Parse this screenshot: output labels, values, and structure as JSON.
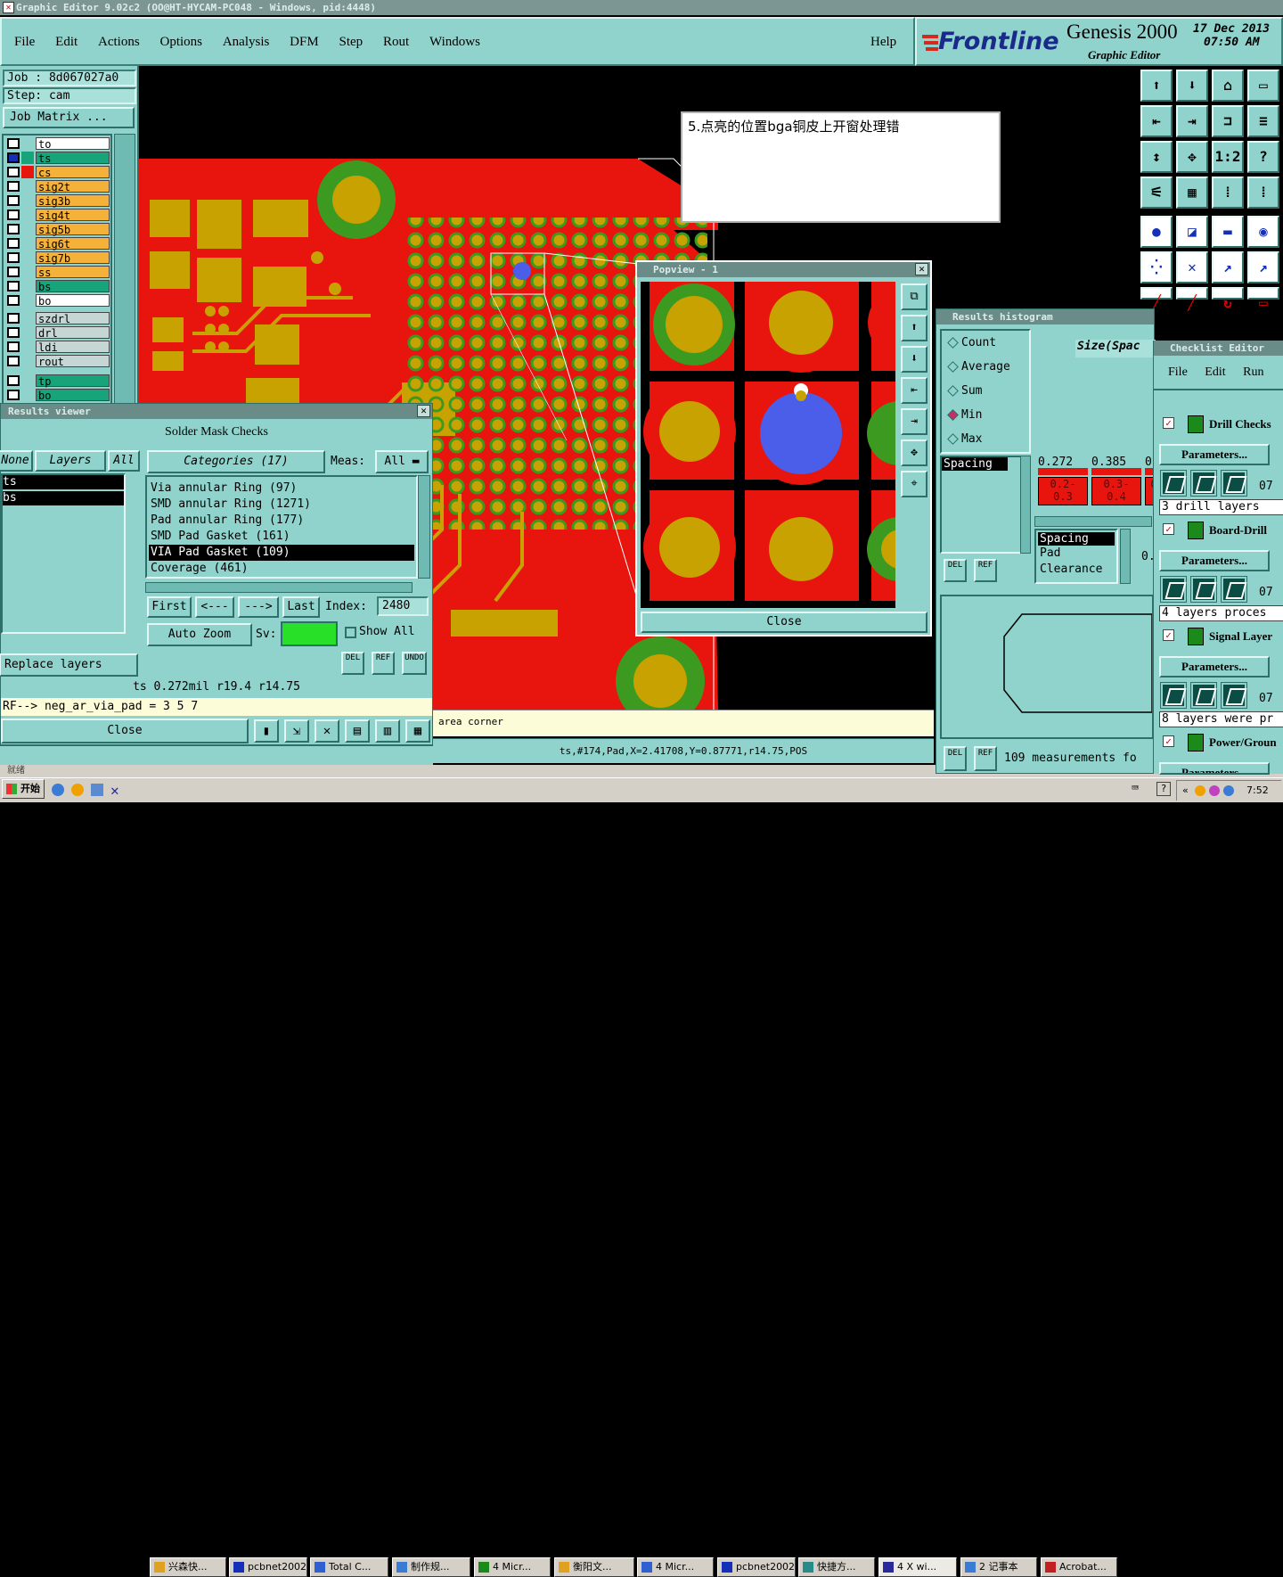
{
  "window_title": "Graphic Editor 9.02c2 (OO@HT-HYCAM-PC048 - Windows, pid:4448)",
  "menu": [
    "File",
    "Edit",
    "Actions",
    "Options",
    "Analysis",
    "DFM",
    "Step",
    "Rout",
    "Windows"
  ],
  "help": "Help",
  "brand": {
    "logo": "Frontline",
    "product": "Genesis 2000",
    "subtitle": "Graphic Editor",
    "date": "17 Dec 2013",
    "time": "07:50 AM"
  },
  "job": {
    "job_label": "Job : 8d067027a0",
    "step_label": "Step: cam",
    "matrix_button": "Job Matrix ..."
  },
  "layers": [
    {
      "name": "to",
      "color": "#ffffff"
    },
    {
      "name": "ts",
      "color": "#18a47a"
    },
    {
      "name": "cs",
      "color": "#f5b23a"
    },
    {
      "name": "sig2t",
      "color": "#f5b23a"
    },
    {
      "name": "sig3b",
      "color": "#f5b23a"
    },
    {
      "name": "sig4t",
      "color": "#f5b23a"
    },
    {
      "name": "sig5b",
      "color": "#f5b23a"
    },
    {
      "name": "sig6t",
      "color": "#f5b23a"
    },
    {
      "name": "sig7b",
      "color": "#f5b23a"
    },
    {
      "name": "ss",
      "color": "#f5b23a"
    },
    {
      "name": "bs",
      "color": "#18a47a"
    },
    {
      "name": "bo",
      "color": "#ffffff"
    }
  ],
  "layers2": [
    "szdrl",
    "drl",
    "ldi",
    "rout"
  ],
  "layers3": [
    "tp",
    "bo"
  ],
  "annotation": "5.点亮的位置bga铜皮上开窗处理错",
  "results_viewer": {
    "title": "Results viewer",
    "header": "Solder Mask Checks",
    "none_btn": "None",
    "layers_btn": "Layers",
    "all_btn": "All",
    "categories_btn": "Categories (17)",
    "meas_label": "Meas:",
    "meas_value": "All",
    "left_list": [
      "ts",
      "bs"
    ],
    "categories": [
      "Via annular Ring (97)",
      "SMD annular Ring (1271)",
      "Pad annular Ring (177)",
      "SMD Pad Gasket (161)",
      "VIA Pad Gasket (109)",
      "Coverage (461)"
    ],
    "selected_index": 4,
    "first": "First",
    "prev": "<---",
    "next": "--->",
    "last": "Last",
    "index_label": "Index:",
    "index_value": "2480",
    "auto_zoom": "Auto Zoom",
    "sv_label": "Sv:",
    "show_all": "Show All",
    "replace_layers": "Replace layers",
    "del": "DEL",
    "ref": "REF",
    "undo": "UNDO",
    "status_line": "ts 0.272mil   r19.4   r14.75",
    "rf_line": "RF--> neg_ar_via_pad = 3 5 7",
    "close": "Close"
  },
  "popview": {
    "title": "Popview - 1",
    "close": "Close"
  },
  "histogram": {
    "title": "Results histogram",
    "options": [
      "Count",
      "Average",
      "Sum",
      "Min",
      "Max"
    ],
    "selected_option": "Min",
    "size_label": "Size(Spac",
    "spacing": "Spacing",
    "bar_values": [
      "0.272",
      "0.385",
      "0"
    ],
    "bins": [
      {
        "top": "0.2-",
        "bot": "0.3"
      },
      {
        "top": "0.3-",
        "bot": "0.4"
      },
      {
        "top": "0",
        "bot": ""
      }
    ],
    "list": [
      "Spacing",
      "Pad",
      "Clearance"
    ],
    "list_zero": "0.",
    "footer": "109 measurements fo"
  },
  "checklist": {
    "title": "Checklist Editor",
    "menu": [
      "File",
      "Edit",
      "Run"
    ],
    "items": [
      {
        "name": "Drill Checks",
        "status": "3 drill layers"
      },
      {
        "name": "Board-Drill",
        "status": "4 layers proces"
      },
      {
        "name": "Signal Layer",
        "status": "8 layers were pr"
      },
      {
        "name": "Power/Groun",
        "status": ""
      }
    ],
    "params": "Parameters...",
    "num": "07"
  },
  "status_bar": {
    "left": "area corner",
    "coords": "ts,#174,Pad,X=2.41708,Y=0.87771,r14.75,POS",
    "bottom_left": "就绪"
  },
  "taskbar": {
    "start": "开始",
    "tasks": [
      "兴森快...",
      "pcbnet2002",
      "Total C...",
      "制作规...",
      "4 Micr...",
      "衡阳文...",
      "4 Micr...",
      "pcbnet2002",
      "快捷方...",
      "4 X wi...",
      "2 记事本",
      "Acrobat..."
    ],
    "clock": "7:52"
  },
  "colors": {
    "copper": "#e8140e",
    "pad": "#c8a200",
    "mask": "#3c9a20",
    "highlight": "#4a5eea",
    "panel": "#8fd3cc"
  }
}
